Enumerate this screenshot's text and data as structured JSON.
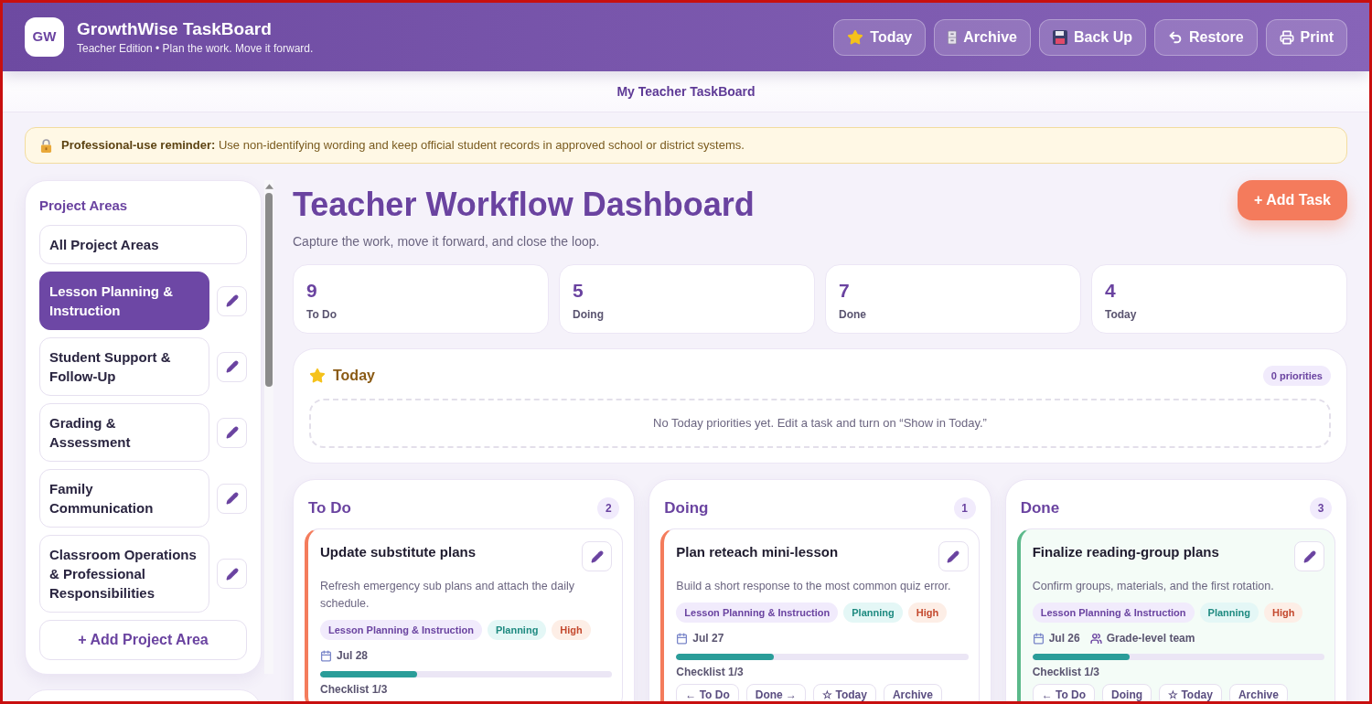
{
  "header": {
    "logo": "GW",
    "title": "GrowthWise TaskBoard",
    "subtitle": "Teacher Edition • Plan the work. Move it forward.",
    "buttons": [
      {
        "kind": "today",
        "label": "Today"
      },
      {
        "kind": "archive",
        "label": "Archive"
      },
      {
        "kind": "backup",
        "label": "Back Up"
      },
      {
        "kind": "restore",
        "label": "Restore"
      },
      {
        "kind": "print",
        "label": "Print"
      }
    ]
  },
  "board_title": "My Teacher TaskBoard",
  "reminder": {
    "text": "**Professional-use reminder:** Use non-identifying wording and keep official student records in approved school or district systems."
  },
  "sidebar": {
    "title": "Project Areas",
    "items": [
      {
        "label": "All Project Areas",
        "selected": false,
        "editable": false
      },
      {
        "label": "Lesson Planning & Instruction",
        "selected": true,
        "editable": true
      },
      {
        "label": "Student Support & Follow-Up",
        "selected": false,
        "editable": true
      },
      {
        "label": "Grading & Assessment",
        "selected": false,
        "editable": true
      },
      {
        "label": "Family Communication",
        "selected": false,
        "editable": true
      },
      {
        "label": "Classroom Operations & Professional Responsibilities",
        "selected": false,
        "editable": true
      }
    ],
    "add_button": "+ Add Project Area"
  },
  "dashboard": {
    "title": "Teacher Workflow Dashboard",
    "subtitle": "Capture the work, move it forward, and close the loop.",
    "add_button": "+ Add Task"
  },
  "stats": [
    {
      "value": "9",
      "label": "To Do"
    },
    {
      "value": "5",
      "label": "Doing"
    },
    {
      "value": "7",
      "label": "Done"
    },
    {
      "value": "4",
      "label": "Today"
    }
  ],
  "today": {
    "title": "Today",
    "count": "0 priorities",
    "empty_message": "No Today priorities yet. Edit a task and turn on “Show in Today.”"
  },
  "columns": [
    {
      "title": "To Do",
      "count": "2",
      "tasks": [
        {
          "title": "Update substitute plans",
          "description": "Refresh emergency sub plans and attach the daily schedule.",
          "completed": false,
          "tags": [
            {
              "kind": "area",
              "label": "Lesson Planning & Instruction"
            },
            {
              "kind": "category",
              "label": "Planning"
            },
            {
              "kind": "priority",
              "label": "High"
            }
          ],
          "due": "Jul 28",
          "progress": {
            "level": 0.333
          },
          "checklist": "Checklist 1/3"
        }
      ]
    },
    {
      "title": "Doing",
      "count": "1",
      "tasks": [
        {
          "title": "Plan reteach mini-lesson",
          "description": "Build a short response to the most common quiz error.",
          "completed": false,
          "tags": [
            {
              "kind": "area",
              "label": "Lesson Planning & Instruction"
            },
            {
              "kind": "category",
              "label": "Planning"
            },
            {
              "kind": "priority",
              "label": "High"
            }
          ],
          "due": "Jul 27",
          "progress": {
            "level": 0.333
          },
          "checklist": "Checklist 1/3",
          "actions": [
            "← To Do",
            "Done →",
            "☆ Today",
            "Archive"
          ]
        }
      ]
    },
    {
      "title": "Done",
      "count": "3",
      "tasks": [
        {
          "title": "Finalize reading-group plans",
          "description": "Confirm groups, materials, and the first rotation.",
          "completed": true,
          "tags": [
            {
              "kind": "area",
              "label": "Lesson Planning & Instruction"
            },
            {
              "kind": "category",
              "label": "Planning"
            },
            {
              "kind": "priority",
              "label": "High"
            }
          ],
          "due": "Jul 26",
          "owner": "Grade-level team",
          "progress": {
            "level": 0.333
          },
          "checklist": "Checklist 1/3",
          "actions": [
            "← To Do",
            "Doing",
            "☆ Today",
            "Archive"
          ]
        }
      ]
    }
  ]
}
